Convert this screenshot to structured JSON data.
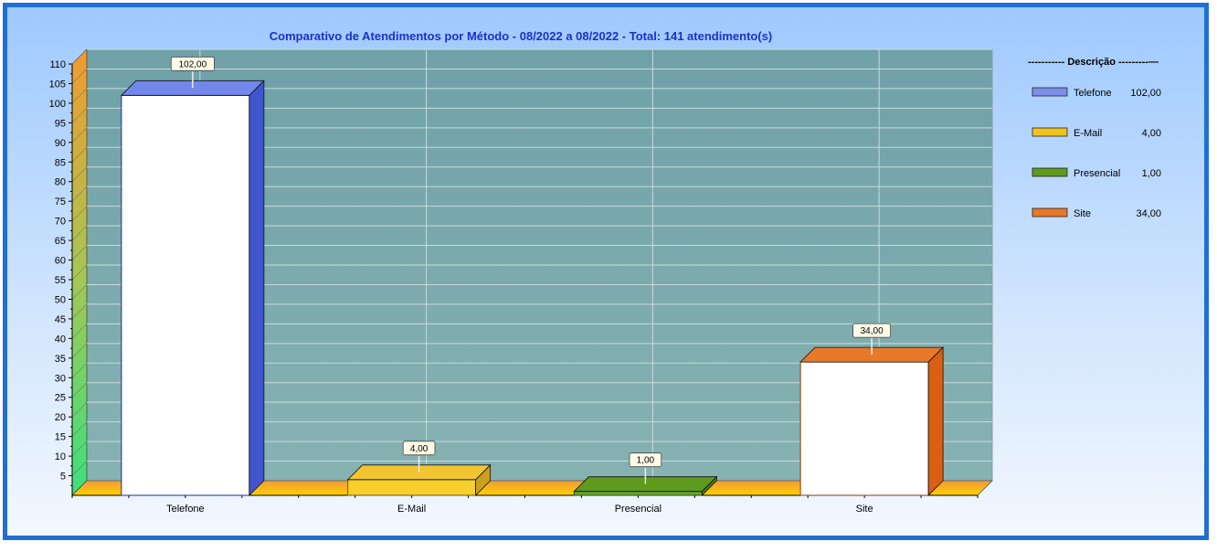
{
  "chart_data": {
    "type": "bar",
    "title": "Comparativo de Atendimentos por Método - 08/2022 a 08/2022 - Total: 141 atendimento(s)",
    "categories": [
      "Telefone",
      "E-Mail",
      "Presencial",
      "Site"
    ],
    "values": [
      102,
      4,
      1,
      34
    ],
    "value_labels": [
      "102,00",
      "4,00",
      "1,00",
      "34,00"
    ],
    "ylim": [
      0,
      110
    ],
    "yticks": [
      5,
      10,
      15,
      20,
      25,
      30,
      35,
      40,
      45,
      50,
      55,
      60,
      65,
      70,
      75,
      80,
      85,
      90,
      95,
      100,
      105,
      110
    ],
    "grid": true,
    "legend": {
      "position": "right",
      "title": "----------- Descrição ---------—",
      "entries": [
        {
          "label": "Telefone",
          "value": "102,00"
        },
        {
          "label": "E-Mail",
          "value": "4,00"
        },
        {
          "label": "Presencial",
          "value": "1,00"
        },
        {
          "label": "Site",
          "value": "34,00"
        }
      ]
    },
    "colors": {
      "Telefone": "#4a63d8",
      "E-Mail": "#f2c31d",
      "Presencial": "#5e9a1c",
      "Site": "#e8782a",
      "plot_background": "#7aa7ad",
      "title_text": "#1f2fc8"
    }
  }
}
